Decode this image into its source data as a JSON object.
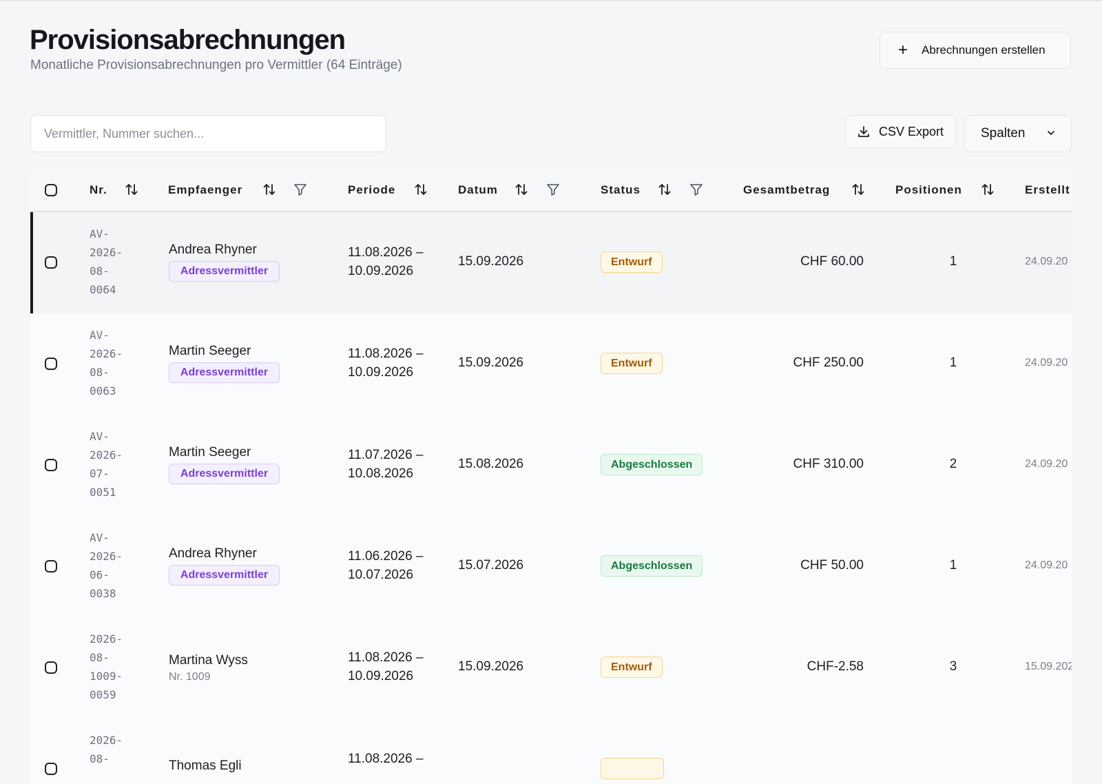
{
  "header": {
    "title": "Provisionsabrechnungen",
    "subtitle": "Monatliche Provisionsabrechnungen pro Vermittler (64 Einträge)",
    "create_label": "Abrechnungen erstellen"
  },
  "toolbar": {
    "search_placeholder": "Vermittler, Nummer suchen...",
    "csv_label": "CSV Export",
    "columns_label": "Spalten"
  },
  "table": {
    "columns": [
      "Nr.",
      "Empfaenger",
      "Periode",
      "Datum",
      "Status",
      "Gesamtbetrag",
      "Positionen",
      "Erstellt"
    ],
    "rows": [
      {
        "nr": "AV-\n2026-\n08-\n0064",
        "name": "Andrea Rhyner",
        "role": "Adressvermittler",
        "sub": "",
        "period": "11.08.2026 –\n10.09.2026",
        "datum": "15.09.2026",
        "status": "Entwurf",
        "status_type": "draft",
        "amount": "CHF 60.00",
        "positions": "1",
        "created": "24.09.20",
        "active": true
      },
      {
        "nr": "AV-\n2026-\n08-\n0063",
        "name": "Martin Seeger",
        "role": "Adressvermittler",
        "sub": "",
        "period": "11.08.2026 –\n10.09.2026",
        "datum": "15.09.2026",
        "status": "Entwurf",
        "status_type": "draft",
        "amount": "CHF 250.00",
        "positions": "1",
        "created": "24.09.20",
        "active": false
      },
      {
        "nr": "AV-\n2026-\n07-\n0051",
        "name": "Martin Seeger",
        "role": "Adressvermittler",
        "sub": "",
        "period": "11.07.2026 –\n10.08.2026",
        "datum": "15.08.2026",
        "status": "Abgeschlossen",
        "status_type": "done",
        "amount": "CHF 310.00",
        "positions": "2",
        "created": "24.09.20",
        "active": false
      },
      {
        "nr": "AV-\n2026-\n06-\n0038",
        "name": "Andrea Rhyner",
        "role": "Adressvermittler",
        "sub": "",
        "period": "11.06.2026 –\n10.07.2026",
        "datum": "15.07.2026",
        "status": "Abgeschlossen",
        "status_type": "done",
        "amount": "CHF 50.00",
        "positions": "1",
        "created": "24.09.20",
        "active": false
      },
      {
        "nr": "2026-\n08-\n1009-\n0059",
        "name": "Martina Wyss",
        "role": "",
        "sub": "Nr. 1009",
        "period": "11.08.2026 –\n10.09.2026",
        "datum": "15.09.2026",
        "status": "Entwurf",
        "status_type": "draft",
        "amount": "CHF-2.58",
        "positions": "3",
        "created": "15.09.202",
        "active": false
      },
      {
        "nr": "2026-\n08-",
        "name": "Thomas Egli",
        "role": "",
        "sub": "",
        "period": "11.08.2026 –",
        "datum": "",
        "status": "",
        "status_type": "draft",
        "amount": "",
        "positions": "",
        "created": "",
        "active": false
      }
    ]
  }
}
